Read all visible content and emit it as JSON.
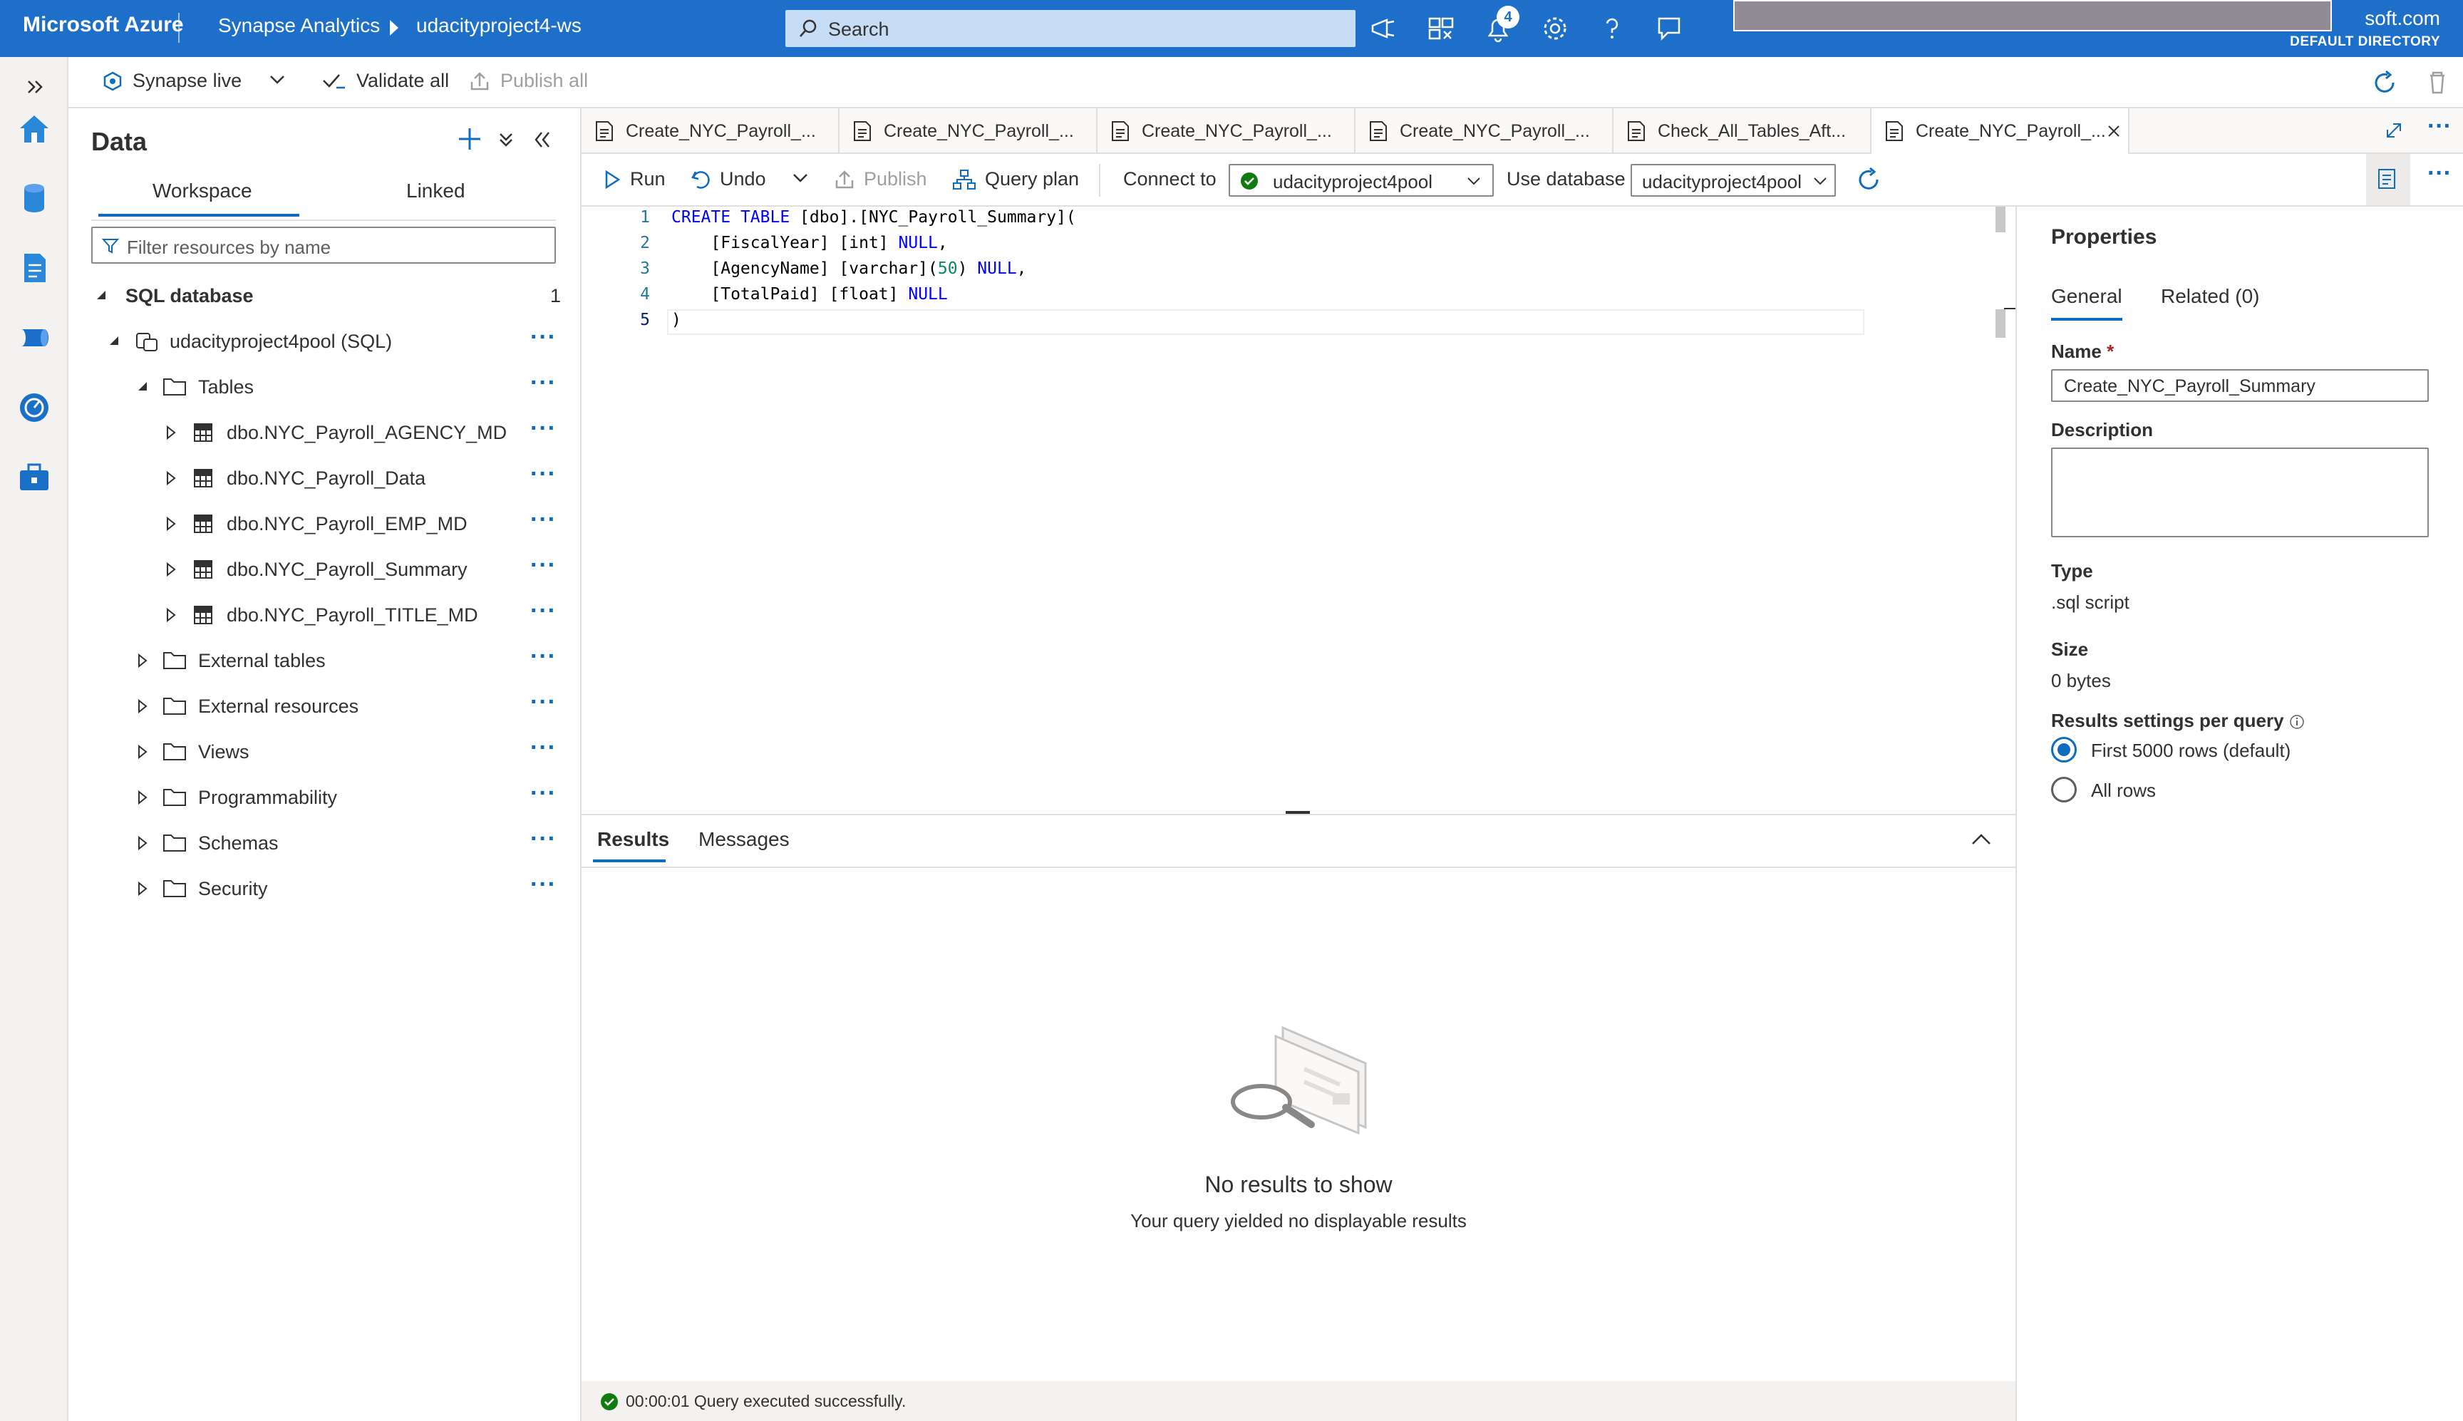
{
  "topbar": {
    "brand": "Microsoft Azure",
    "breadcrumb": [
      "Synapse Analytics",
      "udacityproject4-ws"
    ],
    "search_placeholder": "Search",
    "notification_count": "4",
    "account_suffix": "soft.com",
    "directory": "DEFAULT DIRECTORY"
  },
  "commandbar": {
    "synapse_live": "Synapse live",
    "validate_all": "Validate all",
    "publish_all": "Publish all"
  },
  "datapanel": {
    "title": "Data",
    "tabs": [
      "Workspace",
      "Linked"
    ],
    "filter_placeholder": "Filter resources by name",
    "section_label": "SQL database",
    "section_count": "1",
    "pool": "udacityproject4pool (SQL)",
    "tables_label": "Tables",
    "tables": [
      "dbo.NYC_Payroll_AGENCY_MD",
      "dbo.NYC_Payroll_Data",
      "dbo.NYC_Payroll_EMP_MD",
      "dbo.NYC_Payroll_Summary",
      "dbo.NYC_Payroll_TITLE_MD"
    ],
    "folders": [
      "External tables",
      "External resources",
      "Views",
      "Programmability",
      "Schemas",
      "Security"
    ]
  },
  "doc_tabs": [
    "Create_NYC_Payroll_...",
    "Create_NYC_Payroll_...",
    "Create_NYC_Payroll_...",
    "Create_NYC_Payroll_...",
    "Check_All_Tables_Aft...",
    "Create_NYC_Payroll_..."
  ],
  "editor_toolbar": {
    "run": "Run",
    "undo": "Undo",
    "publish": "Publish",
    "query_plan": "Query plan",
    "connect_to": "Connect to",
    "connect_value": "udacityproject4pool",
    "use_database": "Use database",
    "database_value": "udacityproject4pool"
  },
  "code": {
    "line_numbers": [
      "1",
      "2",
      "3",
      "4",
      "5"
    ],
    "lines": [
      "CREATE TABLE [dbo].[NYC_Payroll_Summary](",
      "    [FiscalYear] [int] NULL,",
      "    [AgencyName] [varchar](50) NULL,",
      "    [TotalPaid] [float] NULL",
      ")"
    ]
  },
  "results": {
    "tabs": [
      "Results",
      "Messages"
    ],
    "empty_title": "No results to show",
    "empty_subtitle": "Your query yielded no displayable results",
    "status": "00:00:01 Query executed successfully."
  },
  "properties": {
    "title": "Properties",
    "tabs": [
      "General",
      "Related (0)"
    ],
    "name_label": "Name",
    "name_value": "Create_NYC_Payroll_Summary",
    "description_label": "Description",
    "type_label": "Type",
    "type_value": ".sql script",
    "size_label": "Size",
    "size_value": "0 bytes",
    "results_label": "Results settings per query",
    "options": [
      "First 5000 rows (default)",
      "All rows"
    ]
  },
  "colors": {
    "topbar": "#1e6fc9",
    "accent": "#0f6cbd",
    "success": "#107c10"
  }
}
